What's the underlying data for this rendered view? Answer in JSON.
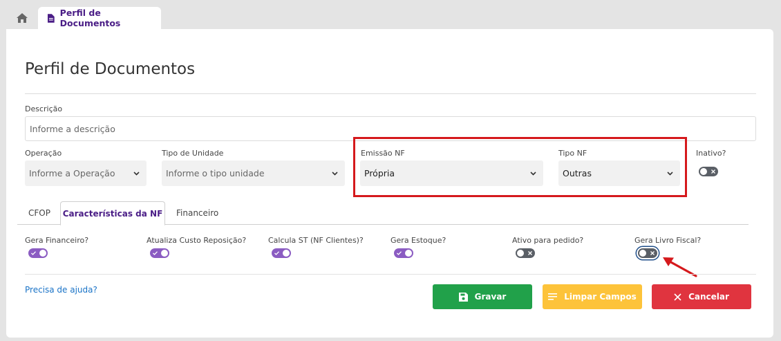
{
  "tabs_bar": {
    "home_icon": "home-icon",
    "page_tab_icon": "document-icon",
    "page_tab_label": "Perfil de Documentos"
  },
  "page": {
    "title": "Perfil de Documentos"
  },
  "form": {
    "descricao_label": "Descrição",
    "descricao_placeholder": "Informe a descrição",
    "operacao_label": "Operação",
    "operacao_value": "Informe a Operação",
    "tipo_unidade_label": "Tipo de Unidade",
    "tipo_unidade_value": "Informe o tipo unidade",
    "emissao_nf_label": "Emissão NF",
    "emissao_nf_value": "Própria",
    "tipo_nf_label": "Tipo NF",
    "tipo_nf_value": "Outras",
    "inativo_label": "Inativo?",
    "inativo_on": false
  },
  "section_tabs": [
    {
      "label": "CFOP",
      "active": false
    },
    {
      "label": "Características da NF",
      "active": true
    },
    {
      "label": "Financeiro",
      "active": false
    }
  ],
  "characteristics": [
    {
      "label": "Gera Financeiro?",
      "on": true
    },
    {
      "label": "Atualiza Custo Reposição?",
      "on": true
    },
    {
      "label": "Calcula ST (NF Clientes)?",
      "on": true
    },
    {
      "label": "Gera Estoque?",
      "on": true
    },
    {
      "label": "Ativo para pedido?",
      "on": false
    },
    {
      "label": "Gera Livro Fiscal?",
      "on": false
    }
  ],
  "footer": {
    "help_link": "Precisa de ajuda?",
    "save_label": "Gravar",
    "clear_label": "Limpar Campos",
    "cancel_label": "Cancelar"
  },
  "colors": {
    "brand_purple": "#4a1d86",
    "toggle_on": "#8b5cc2",
    "toggle_off": "#5a5f66",
    "save": "#21a14a",
    "clear": "#fdc33a",
    "cancel": "#e0343f",
    "highlight": "#d5191c"
  }
}
